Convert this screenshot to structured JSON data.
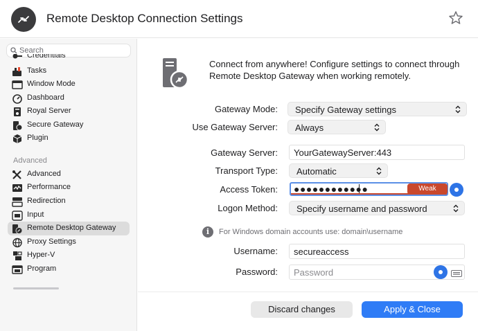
{
  "window": {
    "title": "Remote Desktop Connection Settings"
  },
  "sidebar": {
    "search_placeholder": "Search",
    "items_top": [
      {
        "label": "Credentials",
        "icon": "key-icon"
      },
      {
        "label": "Tasks",
        "icon": "tasks-icon"
      },
      {
        "label": "Window Mode",
        "icon": "window-icon"
      },
      {
        "label": "Dashboard",
        "icon": "dashboard-icon"
      },
      {
        "label": "Royal Server",
        "icon": "royal-server-icon"
      },
      {
        "label": "Secure Gateway",
        "icon": "secure-gateway-icon"
      },
      {
        "label": "Plugin",
        "icon": "plugin-icon"
      }
    ],
    "section_advanced": "Advanced",
    "items_advanced": [
      {
        "label": "Advanced",
        "icon": "tools-icon"
      },
      {
        "label": "Performance",
        "icon": "performance-icon"
      },
      {
        "label": "Redirection",
        "icon": "redirection-icon"
      },
      {
        "label": "Input",
        "icon": "keyboard-icon"
      },
      {
        "label": "Remote Desktop Gateway",
        "icon": "remote-desktop-icon",
        "active": true
      },
      {
        "label": "Proxy Settings",
        "icon": "globe-icon"
      },
      {
        "label": "Hyper-V",
        "icon": "hyperv-icon"
      },
      {
        "label": "Program",
        "icon": "program-icon"
      }
    ]
  },
  "main": {
    "intro": "Connect from anywhere! Configure settings to connect through Remote Desktop Gateway when working remotely.",
    "gateway_mode": {
      "label": "Gateway Mode:",
      "value": "Specify Gateway settings"
    },
    "use_gateway_server": {
      "label": "Use Gateway Server:",
      "value": "Always"
    },
    "gateway_server": {
      "label": "Gateway Server:",
      "value": "YourGatewayServer:443"
    },
    "transport_type": {
      "label": "Transport Type:",
      "value": "Automatic"
    },
    "access_token": {
      "label": "Access Token:",
      "masked": "●●●●●●●●●●●●",
      "strength": "Weak"
    },
    "logon_method": {
      "label": "Logon Method:",
      "value": "Specify username and password"
    },
    "hint": "For Windows domain accounts use: domain\\username",
    "username": {
      "label": "Username:",
      "value": "secureaccess"
    },
    "password": {
      "label": "Password:",
      "placeholder": "Password"
    }
  },
  "footer": {
    "discard": "Discard changes",
    "apply": "Apply & Close"
  },
  "colors": {
    "accent": "#2f7cf6",
    "weak": "#c9482d",
    "focus": "#5b8fe6"
  }
}
